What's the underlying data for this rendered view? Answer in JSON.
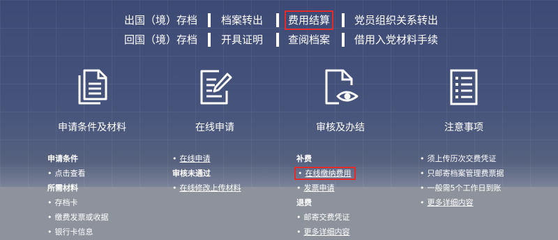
{
  "nav": {
    "row1": [
      "出国（境）存档",
      "档案转出",
      "费用结算",
      "党员组织关系转出"
    ],
    "row2": [
      "回国（境）存档",
      "开具证明",
      "查阅档案",
      "借用入党材料手续"
    ]
  },
  "categories": [
    {
      "label": "申请条件及材料",
      "icon": "documents-icon"
    },
    {
      "label": "在线申请",
      "icon": "edit-form-icon"
    },
    {
      "label": "审核及办结",
      "icon": "view-document-icon"
    },
    {
      "label": "注意事项",
      "icon": "checklist-icon"
    }
  ],
  "col1": {
    "h1": "申请条件",
    "link1": "点击查看",
    "h2": "所需材料",
    "items": [
      "存档卡",
      "缴费发票或收据",
      "银行卡信息"
    ]
  },
  "col2": {
    "link1": "在线申请",
    "h1": "审核未通过",
    "link2": "在线修改上传材料"
  },
  "col3": {
    "h1": "补费",
    "link1": "在线缴纳费用",
    "link2": "发票申请",
    "h2": "退费",
    "item1": "邮寄交费凭证",
    "link3": "更多详细内容"
  },
  "col4": {
    "items": [
      "须上传历次交费凭证",
      "只邮寄档案管理费票据",
      "一般需5个工作日到账"
    ],
    "link1": "更多详细内容"
  },
  "colors": {
    "highlight": "#e22b2b",
    "text": "#ffffff"
  }
}
